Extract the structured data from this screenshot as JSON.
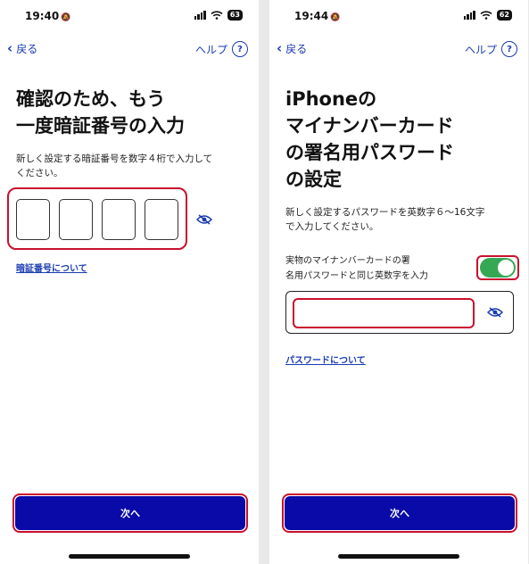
{
  "left": {
    "status": {
      "time": "19:40",
      "battery": "63"
    },
    "nav": {
      "back_label": "戻る",
      "help_label": "ヘルプ",
      "help_icon": "?"
    },
    "title_line1": "確認のため、もう",
    "title_line2": "一度暗証番号の入力",
    "desc_line1": "新しく設定する暗証番号を数字４桁で入力して",
    "desc_line2": "ください。",
    "pin_digits": [
      "",
      "",
      "",
      ""
    ],
    "link": "暗証番号について",
    "next_label": "次へ"
  },
  "right": {
    "status": {
      "time": "19:44",
      "battery": "62"
    },
    "nav": {
      "back_label": "戻る",
      "help_label": "ヘルプ",
      "help_icon": "?"
    },
    "title_line1": "iPhoneの",
    "title_line2": "マイナンバーカード",
    "title_line3": "の署名用パスワード",
    "title_line4": "の設定",
    "desc_line1": "新しく設定するパスワードを英数字６〜16文字",
    "desc_line2": "で入力してください。",
    "toggle_label_line1": "実物のマイナンバーカードの署",
    "toggle_label_line2": "名用パスワードと同じ英数字を入力",
    "toggle_on": true,
    "password_value": "",
    "link": "パスワードについて",
    "next_label": "次へ"
  },
  "colors": {
    "accent": "#1a3bb0",
    "button": "#0a0aa8",
    "highlight": "#c8102e",
    "toggle": "#34a853"
  }
}
